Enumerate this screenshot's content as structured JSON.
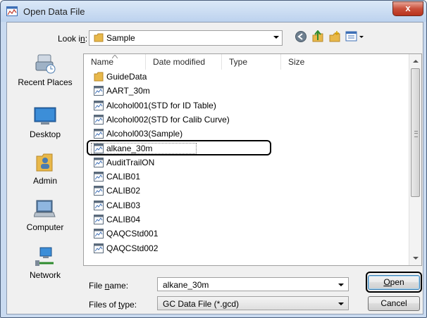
{
  "window": {
    "title": "Open Data File",
    "close_label": "x"
  },
  "toolbar": {
    "lookin_label": "Look in:",
    "lookin_value": "Sample",
    "icons": [
      "back-icon",
      "up-folder-icon",
      "new-folder-icon",
      "views-menu-icon"
    ]
  },
  "places": [
    {
      "name": "recent-places",
      "label": "Recent Places"
    },
    {
      "name": "desktop",
      "label": "Desktop"
    },
    {
      "name": "admin",
      "label": "Admin"
    },
    {
      "name": "computer",
      "label": "Computer"
    },
    {
      "name": "network",
      "label": "Network"
    }
  ],
  "filelist": {
    "columns": [
      "Name",
      "Date modified",
      "Type",
      "Size"
    ],
    "sort_column": "Name",
    "items": [
      {
        "name": "GuideData",
        "kind": "folder"
      },
      {
        "name": "AART_30m",
        "kind": "file"
      },
      {
        "name": "Alcohol001(STD for ID Table)",
        "kind": "file"
      },
      {
        "name": "Alcohol002(STD for Calib Curve)",
        "kind": "file"
      },
      {
        "name": "Alcohol003(Sample)",
        "kind": "file"
      },
      {
        "name": "alkane_30m",
        "kind": "file",
        "selected": true
      },
      {
        "name": "AuditTrailON",
        "kind": "file"
      },
      {
        "name": "CALIB01",
        "kind": "file"
      },
      {
        "name": "CALIB02",
        "kind": "file"
      },
      {
        "name": "CALIB03",
        "kind": "file"
      },
      {
        "name": "CALIB04",
        "kind": "file"
      },
      {
        "name": "QAQCStd001",
        "kind": "file"
      },
      {
        "name": "QAQCStd002",
        "kind": "file"
      }
    ]
  },
  "filename": {
    "label": "File name:",
    "value": "alkane_30m"
  },
  "filetype": {
    "label": "Files of type:",
    "value": "GC Data File (*.gcd)"
  },
  "buttons": {
    "open": "Open",
    "cancel": "Cancel"
  },
  "colors": {
    "titlebar": "#bcd2ee",
    "close": "#c94f3a",
    "folder": "#e8b84a",
    "highlight_outline": "#000000"
  }
}
